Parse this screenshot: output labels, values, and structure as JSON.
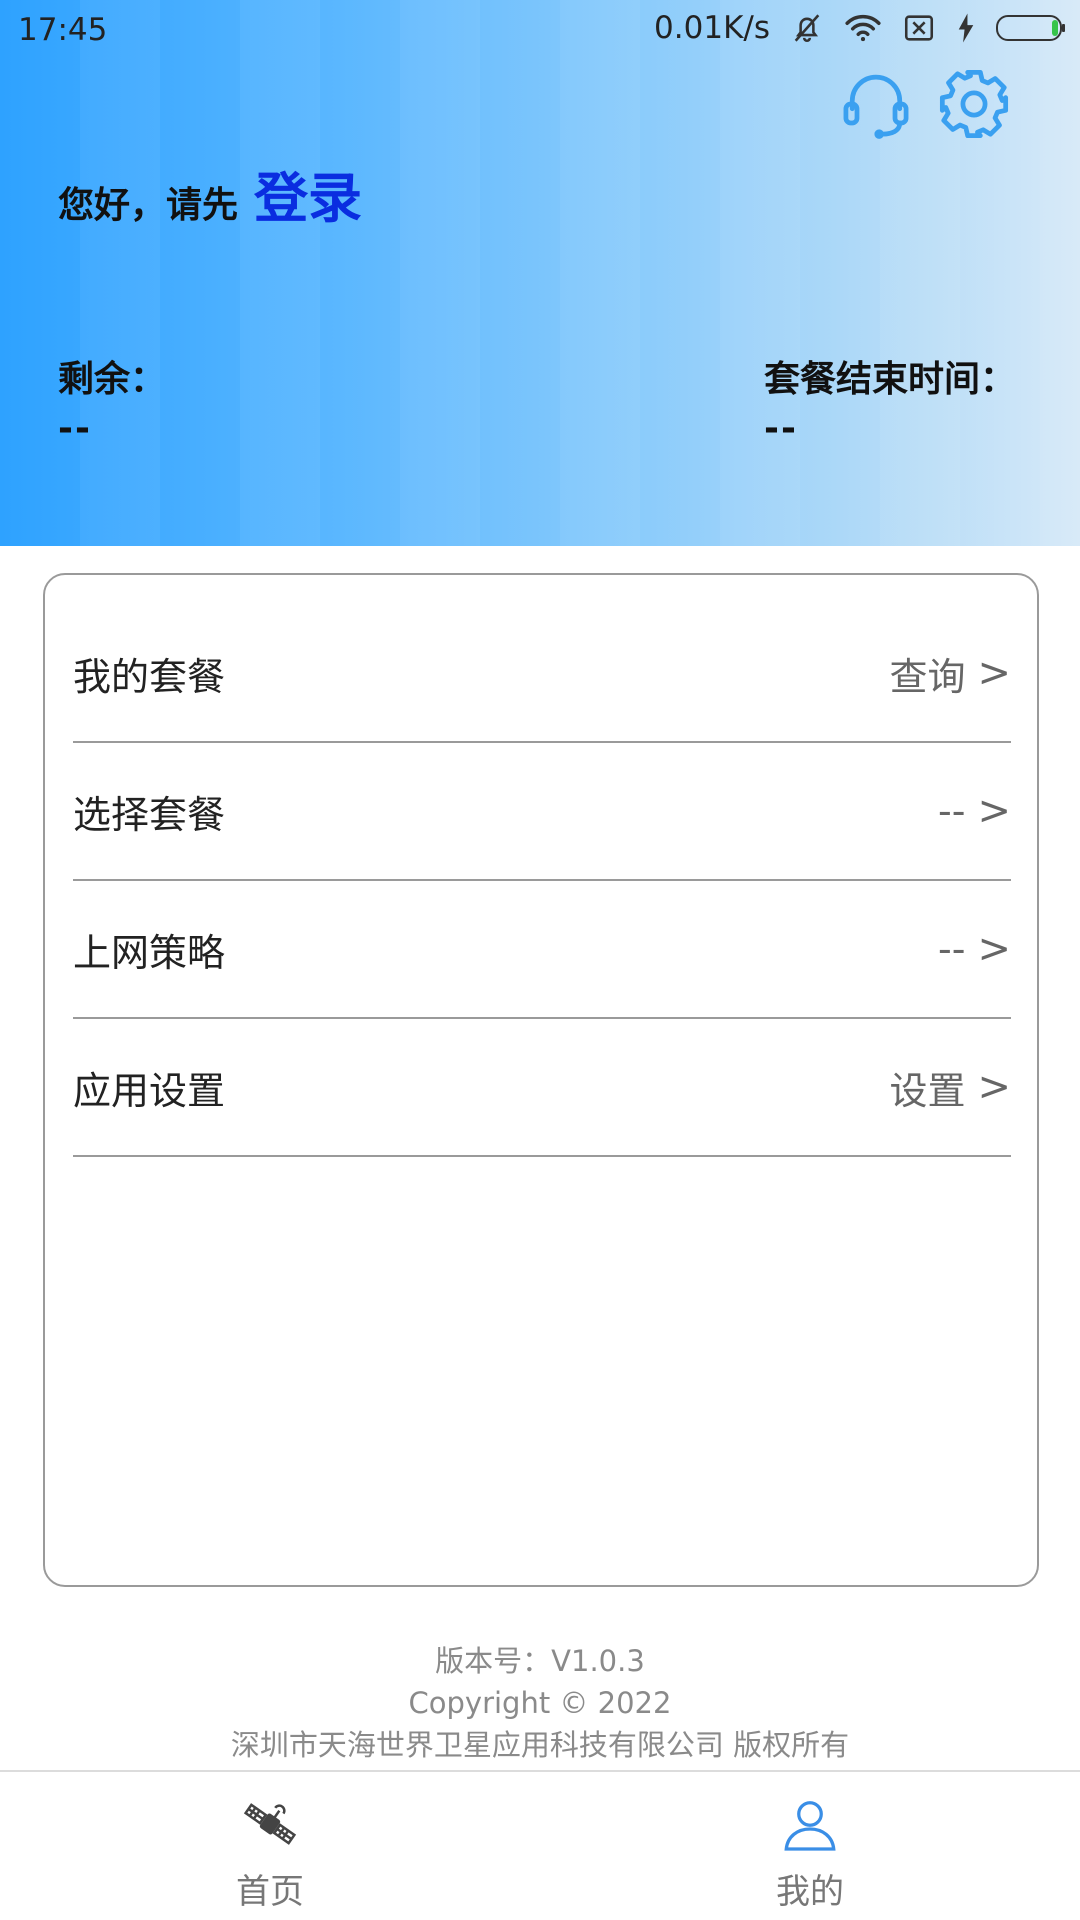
{
  "status_bar": {
    "time": "17:45",
    "net_speed": "0.01K/s",
    "icons": [
      "bell-muted-icon",
      "wifi-icon",
      "sim-disabled-icon",
      "charging-icon",
      "battery-icon"
    ]
  },
  "header": {
    "greeting": "您好，请先",
    "login_label": "登录",
    "remaining_label": "剩余：",
    "remaining_value": "--",
    "end_time_label": "套餐结束时间：",
    "end_time_value": "--",
    "icons": [
      "headset-icon",
      "gear-icon"
    ],
    "accent_color": "#3aa0f0",
    "login_color": "#0a2de0"
  },
  "menu": {
    "items": [
      {
        "label": "我的套餐",
        "action": "查询"
      },
      {
        "label": "选择套餐",
        "action": "--"
      },
      {
        "label": "上网策略",
        "action": "--"
      },
      {
        "label": "应用设置",
        "action": "设置"
      }
    ],
    "chevron": ">"
  },
  "footer": {
    "version": "版本号：V1.0.3",
    "copyright": "Copyright © 2022",
    "company": "深圳市天海世界卫星应用科技有限公司 版权所有"
  },
  "tab_bar": {
    "tabs": [
      {
        "label": "首页",
        "icon": "satellite-icon"
      },
      {
        "label": "我的",
        "icon": "user-icon"
      }
    ],
    "active_color": "#3a8ee6"
  }
}
